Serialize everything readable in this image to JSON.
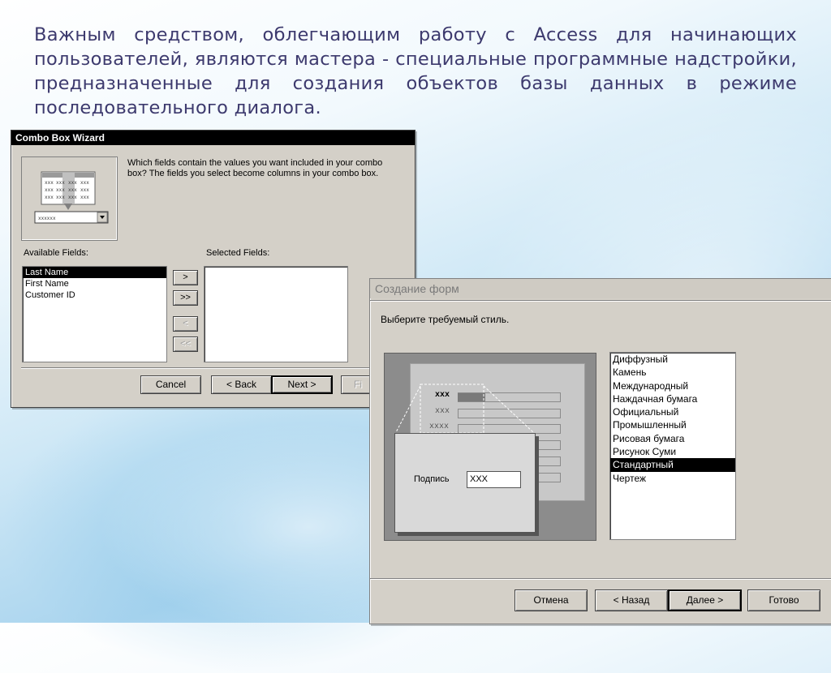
{
  "slide": {
    "heading": "Важным средством, облегчающим работу с Access для начинающих пользователей, являются мастера - специальные программные надстройки, предназначенные для создания объектов базы данных в режиме последовательного диалога."
  },
  "combo_wizard": {
    "title": "Combo Box Wizard",
    "prompt": "Which fields contain the values you want included in your combo box? The fields you select become columns in your combo box.",
    "illustration_cell": "xxx",
    "illustration_combo": "xxxxxx",
    "available_label": "Available Fields:",
    "selected_label": "Selected Fields:",
    "available_fields": [
      "Last Name",
      "First Name",
      "Customer ID"
    ],
    "selected_index": 0,
    "selected_fields": [],
    "move_one": ">",
    "move_all": ">>",
    "remove_one": "<",
    "remove_all": "<<",
    "cancel": "Cancel",
    "back": "< Back",
    "next": "Next >",
    "finish_partial": "Fi"
  },
  "form_wizard": {
    "title": "Создание форм",
    "prompt": "Выберите требуемый стиль.",
    "styles": [
      "Диффузный",
      "Камень",
      "Международный",
      "Наждачная бумага",
      "Официальный",
      "Промышленный",
      "Рисовая бумага",
      "Рисунок Суми",
      "Стандартный",
      "Чертеж"
    ],
    "selected_style_index": 8,
    "preview": {
      "labels": [
        "xxx",
        "xxx",
        "xxxx"
      ],
      "caption_label": "Подпись",
      "caption_value": "XXX"
    },
    "cancel": "Отмена",
    "back": "< Назад",
    "next": "Далее >",
    "finish": "Готово"
  },
  "colors": {
    "heading_text": "#3d3a6e",
    "dialog_face": "#d4d0c8",
    "selection": "#000000"
  }
}
